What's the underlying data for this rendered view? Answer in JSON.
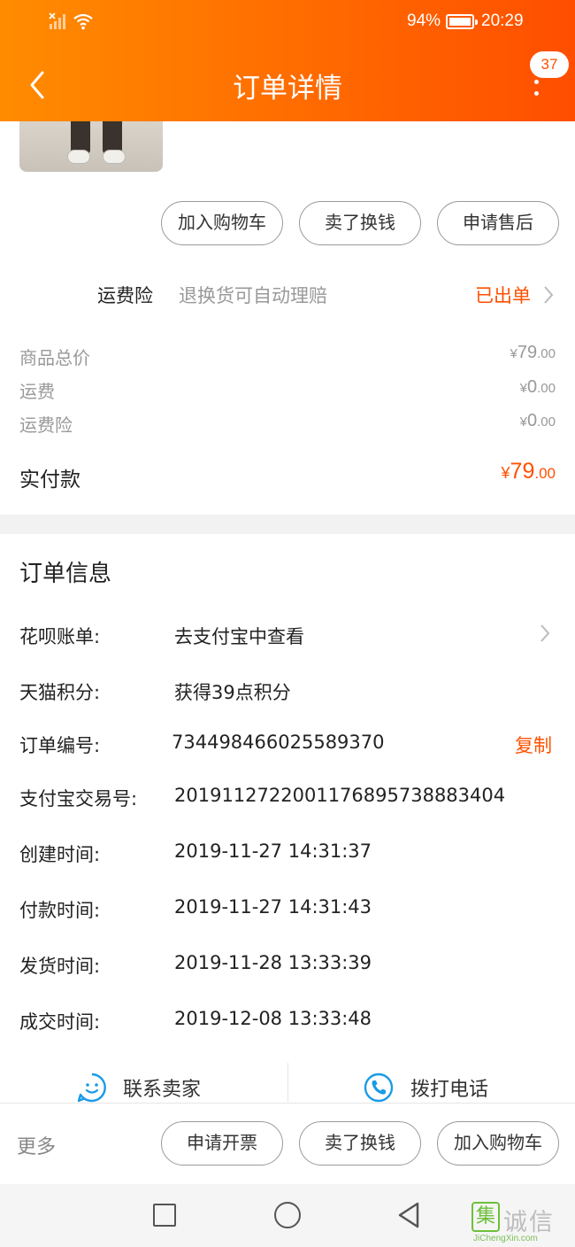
{
  "status_bar": {
    "battery": "94%",
    "time": "20:29"
  },
  "header": {
    "title": "订单详情",
    "badge_count": "37"
  },
  "item_actions": {
    "add_to_cart": "加入购物车",
    "sell_for_cash": "卖了换钱",
    "after_sale": "申请售后"
  },
  "shipping_insurance": {
    "label": "运费险",
    "description": "退换货可自动理赔",
    "status": "已出单"
  },
  "price_summary": {
    "rows": [
      {
        "label": "商品总价",
        "currency": "¥",
        "integer": "79",
        "decimal": ".00"
      },
      {
        "label": "运费",
        "currency": "¥",
        "integer": "0",
        "decimal": ".00"
      },
      {
        "label": "运费险",
        "currency": "¥",
        "integer": "0",
        "decimal": ".00"
      }
    ],
    "total": {
      "label": "实付款",
      "currency": "¥",
      "integer": "79",
      "decimal": ".00"
    }
  },
  "order_info": {
    "heading": "订单信息",
    "rows": [
      {
        "label": "花呗账单:",
        "value": "去支付宝中查看"
      },
      {
        "label": "天猫积分:",
        "value": "获得39点积分"
      },
      {
        "label": "订单编号:",
        "value": "734498466025589370"
      },
      {
        "label": "支付宝交易号:",
        "value": "2019112722001176895738883404"
      },
      {
        "label": "创建时间:",
        "value": "2019-11-27 14:31:37"
      },
      {
        "label": "付款时间:",
        "value": "2019-11-27 14:31:43"
      },
      {
        "label": "发货时间:",
        "value": "2019-11-28 13:33:39"
      },
      {
        "label": "成交时间:",
        "value": "2019-12-08 13:33:48"
      }
    ],
    "copy_label": "复制"
  },
  "contact": {
    "seller": "联系卖家",
    "call": "拨打电话"
  },
  "bottom_bar": {
    "more": "更多",
    "invoice": "申请开票",
    "sell_for_cash": "卖了换钱",
    "add_to_cart": "加入购物车"
  },
  "watermark": {
    "mark": "集",
    "text": "诚信",
    "url": "JiChengXin.com"
  },
  "colors": {
    "accent": "#ff5000",
    "header_start": "#ff8c00",
    "header_end": "#ff4e00",
    "link_blue": "#1a9be6"
  },
  "icons": [
    "signal-icon",
    "wifi-icon",
    "battery-icon",
    "back-arrow-icon",
    "more-vertical-icon",
    "chevron-right-icon",
    "smile-chat-icon",
    "phone-icon"
  ]
}
